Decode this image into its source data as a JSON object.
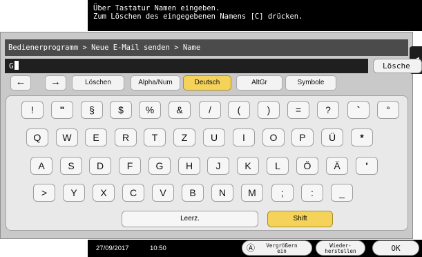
{
  "message": {
    "line1": "Über Tastatur Namen eingeben.",
    "line2": "Zum Löschen des eingegebenen Namens [C] drücken."
  },
  "breadcrumb": "Bedienerprogramm > Neue E-Mail senden > Name",
  "input": {
    "value": "G"
  },
  "clear_button": "Lösche",
  "side_tab_icon": "arrow-left-icon",
  "toolbar": {
    "left_arrow": "←",
    "right_arrow": "→",
    "delete": "Löschen",
    "alphanum": "Alpha/Num",
    "deutsch": "Deutsch",
    "altgr": "AltGr",
    "symbole": "Symbole",
    "selected": "Deutsch",
    "selected_color": "#f5d35a"
  },
  "keyboard": {
    "row1": [
      "!",
      "\"",
      "§",
      "$",
      "%",
      "&",
      "/",
      "(",
      ")",
      "=",
      "?",
      "`",
      "°"
    ],
    "row2": [
      "Q",
      "W",
      "E",
      "R",
      "T",
      "Z",
      "U",
      "I",
      "O",
      "P",
      "Ü",
      "*"
    ],
    "row3": [
      "A",
      "S",
      "D",
      "F",
      "G",
      "H",
      "J",
      "K",
      "L",
      "Ö",
      "Ä",
      "'"
    ],
    "row4": [
      ">",
      "Y",
      "X",
      "C",
      "V",
      "B",
      "N",
      "M",
      ";",
      ":",
      "_"
    ],
    "space": "Leerz.",
    "shift": "Shift"
  },
  "status": {
    "date": "27/09/2017",
    "time": "10:50",
    "zoom_line1": "Vergrößern",
    "zoom_line2": "ein",
    "restore_line1": "Wieder-",
    "restore_line2": "herstellen",
    "ok": "OK"
  }
}
